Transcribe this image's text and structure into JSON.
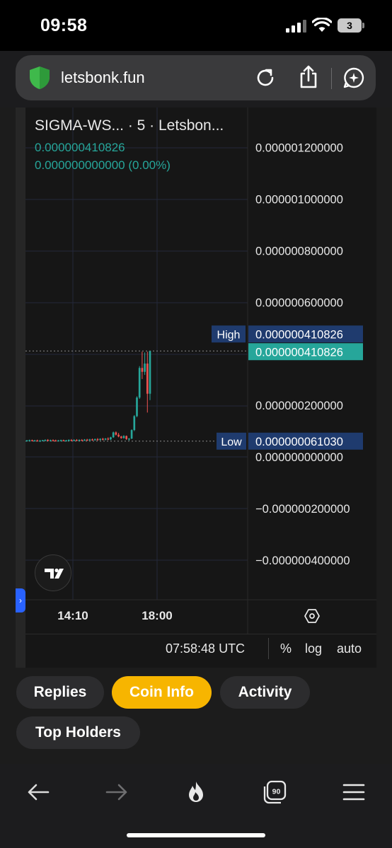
{
  "status_bar": {
    "time": "09:58",
    "battery_level": "3",
    "icons": [
      "signal-icon",
      "wifi-icon",
      "battery-icon"
    ]
  },
  "browser": {
    "url": "letsbonk.fun",
    "icons": [
      "shield-icon",
      "reload-icon",
      "share-icon",
      "assistant-icon"
    ]
  },
  "chart": {
    "symbol_title": "SIGMA-WS... · 5 · Letsbon...",
    "last_price": "0.000000410826",
    "change": "0.000000000000 (0.00%)",
    "high_label": "High",
    "high_value": "0.000000410826",
    "current_value": "0.000000410826",
    "low_label": "Low",
    "low_value": "0.000000061030",
    "utc_time": "07:58:48 UTC",
    "controls": [
      "%",
      "log",
      "auto"
    ],
    "colors": {
      "up": "#26a69a",
      "down": "#ef5350",
      "badge": "#1f3b6e",
      "panel": "#161616"
    }
  },
  "chart_data": {
    "type": "candlestick",
    "title": "SIGMA-WS... · 5 · Letsbon...",
    "xlabel": "",
    "ylabel": "",
    "x_tick_labels": [
      "14:10",
      "18:00"
    ],
    "y_tick_labels": [
      "0.000001200000",
      "0.000001000000",
      "0.000000800000",
      "0.000000600000",
      "0.000000200000",
      "0.000000000000",
      "−0.000000200000",
      "−0.000000400000"
    ],
    "y_ticks": [
      1.2e-06,
      1e-06,
      8e-07,
      6e-07,
      2e-07,
      0,
      -2e-07,
      -4e-07
    ],
    "ylim": [
      -5.5e-07,
      1.35e-06
    ],
    "high": 4.10826e-07,
    "low": 6.103e-08,
    "last": 4.10826e-07,
    "grid": true,
    "candles": [
      {
        "o": 6.3e-08,
        "h": 6.6e-08,
        "l": 6.1e-08,
        "c": 6.4e-08
      },
      {
        "o": 6.4e-08,
        "h": 6.7e-08,
        "l": 6.1e-08,
        "c": 6.5e-08
      },
      {
        "o": 6.5e-08,
        "h": 6.7e-08,
        "l": 6.1e-08,
        "c": 6.2e-08
      },
      {
        "o": 6.2e-08,
        "h": 6.6e-08,
        "l": 6.1e-08,
        "c": 6.4e-08
      },
      {
        "o": 6.4e-08,
        "h": 6.7e-08,
        "l": 6.1e-08,
        "c": 6.2e-08
      },
      {
        "o": 6.2e-08,
        "h": 6.6e-08,
        "l": 6.1e-08,
        "c": 6.3e-08
      },
      {
        "o": 6.3e-08,
        "h": 6.6e-08,
        "l": 6.1e-08,
        "c": 6.5e-08
      },
      {
        "o": 6.5e-08,
        "h": 6.8e-08,
        "l": 6.1e-08,
        "c": 6.6e-08
      },
      {
        "o": 6.6e-08,
        "h": 6.9e-08,
        "l": 6.1e-08,
        "c": 6.3e-08
      },
      {
        "o": 6.3e-08,
        "h": 6.7e-08,
        "l": 6.1e-08,
        "c": 6.5e-08
      },
      {
        "o": 6.5e-08,
        "h": 6.8e-08,
        "l": 6.1e-08,
        "c": 6.4e-08
      },
      {
        "o": 6.4e-08,
        "h": 6.7e-08,
        "l": 6.1e-08,
        "c": 6.3e-08
      },
      {
        "o": 6.3e-08,
        "h": 6.6e-08,
        "l": 6.1e-08,
        "c": 6.4e-08
      },
      {
        "o": 6.4e-08,
        "h": 6.7e-08,
        "l": 6.1e-08,
        "c": 6.5e-08
      },
      {
        "o": 6.5e-08,
        "h": 6.7e-08,
        "l": 6.1e-08,
        "c": 6.2e-08
      },
      {
        "o": 6.2e-08,
        "h": 6.6e-08,
        "l": 6.1e-08,
        "c": 6.4e-08
      },
      {
        "o": 6.4e-08,
        "h": 6.8e-08,
        "l": 6.1e-08,
        "c": 6.6e-08
      },
      {
        "o": 6.6e-08,
        "h": 6.9e-08,
        "l": 6.1e-08,
        "c": 6.3e-08
      },
      {
        "o": 6.3e-08,
        "h": 6.8e-08,
        "l": 6.1e-08,
        "c": 6.6e-08
      },
      {
        "o": 6.6e-08,
        "h": 6.9e-08,
        "l": 6.2e-08,
        "c": 6.4e-08
      },
      {
        "o": 6.4e-08,
        "h": 6.8e-08,
        "l": 6.2e-08,
        "c": 6.6e-08
      },
      {
        "o": 6.6e-08,
        "h": 6.9e-08,
        "l": 6.2e-08,
        "c": 6.5e-08
      },
      {
        "o": 6.5e-08,
        "h": 6.9e-08,
        "l": 6.2e-08,
        "c": 6.7e-08
      },
      {
        "o": 6.7e-08,
        "h": 7e-08,
        "l": 6.2e-08,
        "c": 6.4e-08
      },
      {
        "o": 6.4e-08,
        "h": 7e-08,
        "l": 6.2e-08,
        "c": 6.8e-08
      },
      {
        "o": 6.8e-08,
        "h": 7.1e-08,
        "l": 6.3e-08,
        "c": 6.5e-08
      },
      {
        "o": 6.5e-08,
        "h": 7.1e-08,
        "l": 6.3e-08,
        "c": 6.9e-08
      },
      {
        "o": 6.9e-08,
        "h": 7.3e-08,
        "l": 6.3e-08,
        "c": 6.6e-08
      },
      {
        "o": 6.6e-08,
        "h": 7.2e-08,
        "l": 6.3e-08,
        "c": 7e-08
      },
      {
        "o": 7e-08,
        "h": 7.4e-08,
        "l": 6.4e-08,
        "c": 6.7e-08
      },
      {
        "o": 6.7e-08,
        "h": 7.3e-08,
        "l": 6.4e-08,
        "c": 7.1e-08
      },
      {
        "o": 7.1e-08,
        "h": 7.6e-08,
        "l": 6.5e-08,
        "c": 6.8e-08
      },
      {
        "o": 6.8e-08,
        "h": 7.8e-08,
        "l": 6.5e-08,
        "c": 7.6e-08
      },
      {
        "o": 7.6e-08,
        "h": 9.8e-08,
        "l": 7.4e-08,
        "c": 9.5e-08
      },
      {
        "o": 9.5e-08,
        "h": 9.9e-08,
        "l": 8.3e-08,
        "c": 8.6e-08
      },
      {
        "o": 8.6e-08,
        "h": 9.3e-08,
        "l": 7.6e-08,
        "c": 7.9e-08
      },
      {
        "o": 7.9e-08,
        "h": 8.2e-08,
        "l": 7e-08,
        "c": 7.3e-08
      },
      {
        "o": 7.3e-08,
        "h": 8.4e-08,
        "l": 7.1e-08,
        "c": 8.1e-08
      },
      {
        "o": 8.1e-08,
        "h": 8.3e-08,
        "l": 6.6e-08,
        "c": 6.9e-08
      },
      {
        "o": 6.9e-08,
        "h": 7.3e-08,
        "l": 6.3e-08,
        "c": 7.1e-08
      },
      {
        "o": 7.1e-08,
        "h": 1.07e-07,
        "l": 6.9e-08,
        "c": 1.04e-07
      },
      {
        "o": 1.04e-07,
        "h": 1.62e-07,
        "l": 1e-07,
        "c": 1.58e-07
      },
      {
        "o": 1.58e-07,
        "h": 2.35e-07,
        "l": 1.54e-07,
        "c": 2.3e-07
      },
      {
        "o": 2.3e-07,
        "h": 3.52e-07,
        "l": 2.25e-07,
        "c": 3.45e-07
      },
      {
        "o": 3.45e-07,
        "h": 4.08e-07,
        "l": 3.02e-07,
        "c": 3.3e-07
      },
      {
        "o": 3.3e-07,
        "h": 4.05e-07,
        "l": 3.18e-07,
        "c": 3.62e-07
      },
      {
        "o": 3.62e-07,
        "h": 4.08e-07,
        "l": 1.72e-07,
        "c": 2.45e-07
      },
      {
        "o": 2.45e-07,
        "h": 4.10826e-07,
        "l": 2.2e-07,
        "c": 4.10826e-07
      }
    ]
  },
  "tabs": [
    {
      "label": "Replies",
      "active": false
    },
    {
      "label": "Coin Info",
      "active": true
    },
    {
      "label": "Activity",
      "active": false
    },
    {
      "label": "Top Holders",
      "active": false
    }
  ],
  "toolbar": {
    "icons": [
      "back-icon",
      "forward-icon",
      "flame-icon",
      "tabs-icon",
      "menu-icon"
    ],
    "tab_count": "90"
  }
}
